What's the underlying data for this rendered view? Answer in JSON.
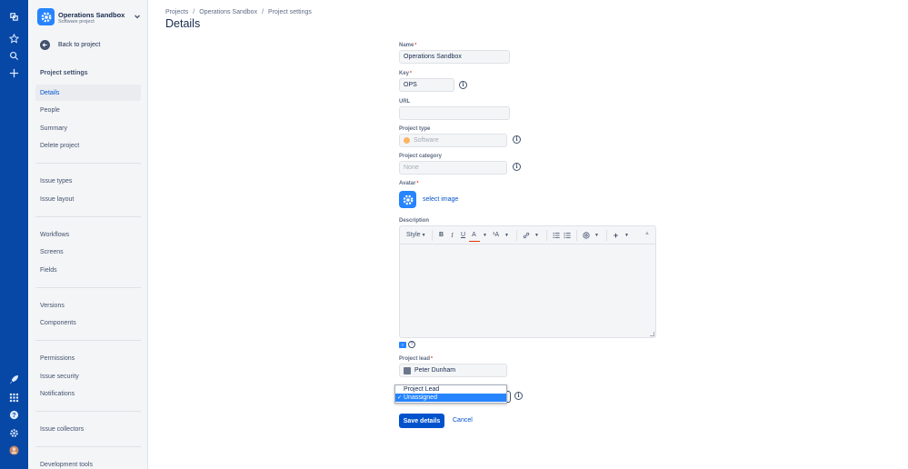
{
  "sidebar": {
    "project_name": "Operations Sandbox",
    "project_type": "Software project",
    "back_label": "Back to project",
    "section_title": "Project settings",
    "groups": [
      [
        "Details",
        "People",
        "Summary",
        "Delete project"
      ],
      [
        "Issue types",
        "Issue layout"
      ],
      [
        "Workflows",
        "Screens",
        "Fields"
      ],
      [
        "Versions",
        "Components"
      ],
      [
        "Permissions",
        "Issue security",
        "Notifications"
      ],
      [
        "Issue collectors"
      ],
      [
        "Development tools"
      ]
    ],
    "active_item": "Details"
  },
  "breadcrumbs": [
    "Projects",
    "Operations Sandbox",
    "Project settings"
  ],
  "page_title": "Details",
  "form": {
    "name_label": "Name",
    "name_value": "Operations Sandbox",
    "key_label": "Key",
    "key_value": "OPS",
    "url_label": "URL",
    "url_value": "",
    "type_label": "Project type",
    "type_value": "Software",
    "category_label": "Project category",
    "category_value": "None",
    "avatar_label": "Avatar",
    "select_image": "select image",
    "description_label": "Description",
    "toolbar": {
      "style": "Style",
      "bold": "B",
      "italic": "I",
      "underline": "U",
      "color": "A",
      "size": "¹A",
      "more": "+"
    },
    "lead_label": "Project lead",
    "lead_value": "Peter Dunham",
    "assignee_options": [
      "Project Lead",
      "Unassigned"
    ],
    "assignee_selected": "Unassigned",
    "save_label": "Save details",
    "cancel_label": "Cancel"
  },
  "colors": {
    "nav": "#0747a6",
    "primary": "#0052cc",
    "accent": "#2684ff"
  }
}
